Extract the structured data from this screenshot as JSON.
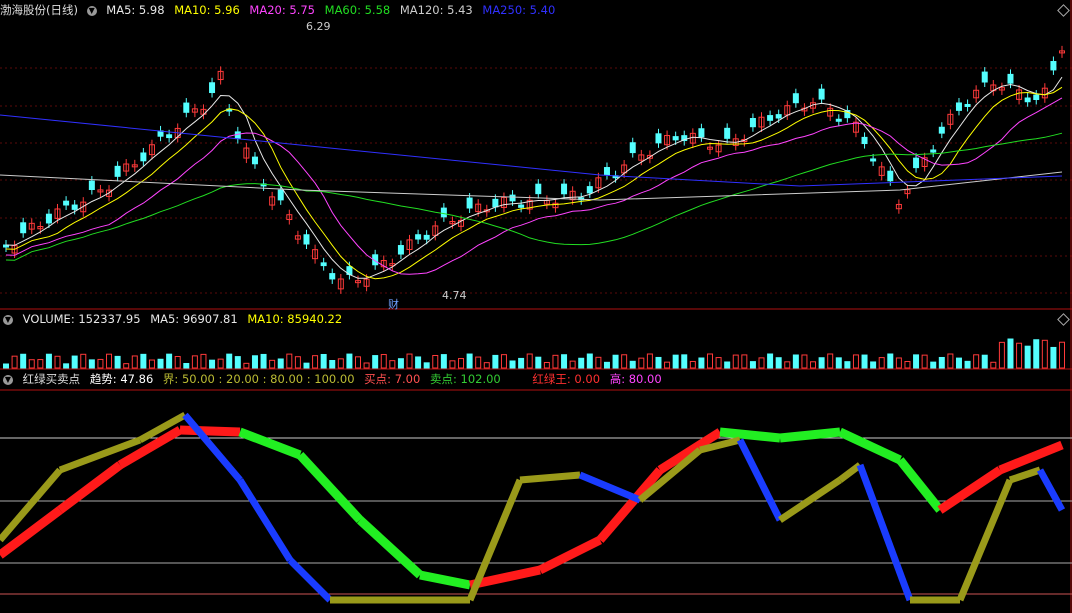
{
  "colors": {
    "up": "#ff3a3a",
    "down": "#54ffff",
    "ma5": "#e8e8e8",
    "ma10": "#ffff00",
    "ma20": "#ff44ff",
    "ma60": "#22dd22",
    "ma120": "#cccccc",
    "ma250": "#3030ff",
    "divider": "#b01010"
  },
  "main": {
    "title": "渤海股份(日线)",
    "ma": [
      {
        "label": "MA5: 5.98",
        "color": "#e8e8e8"
      },
      {
        "label": "MA10: 5.96",
        "color": "#ffff00"
      },
      {
        "label": "MA20: 5.75",
        "color": "#ff44ff"
      },
      {
        "label": "MA60: 5.58",
        "color": "#22dd22"
      },
      {
        "label": "MA120: 5.43",
        "color": "#cccccc"
      },
      {
        "label": "MA250: 5.40",
        "color": "#3030ff"
      }
    ],
    "high_label": "6.29",
    "low_label": "4.74",
    "marker": "财"
  },
  "volume": {
    "items": [
      {
        "label": "VOLUME: 152337.95",
        "color": "#e8e8e8"
      },
      {
        "label": "MA5: 96907.81",
        "color": "#e8e8e8"
      },
      {
        "label": "MA10: 85940.22",
        "color": "#ffff00"
      }
    ]
  },
  "indicator": {
    "name": "红绿买卖点",
    "items": [
      {
        "label": "趋势: 47.86",
        "color": "#ffffff"
      },
      {
        "label": "界: 50.00 : 20.00 : 80.00 : 100.00",
        "color": "#bbbb33"
      },
      {
        "label": "买点: 7.00",
        "color": "#ff5050"
      },
      {
        "label": "卖点: 102.00",
        "color": "#33cc33"
      },
      {
        "label": "红绿王: 0.00",
        "color": "#ff3030"
      },
      {
        "label": "高: 80.00",
        "color": "#ff44ff"
      }
    ]
  },
  "chart_data": {
    "type": "candlestick",
    "y_high": 6.29,
    "y_low": 4.74,
    "indicator_levels": [
      20,
      50,
      80,
      100
    ]
  }
}
